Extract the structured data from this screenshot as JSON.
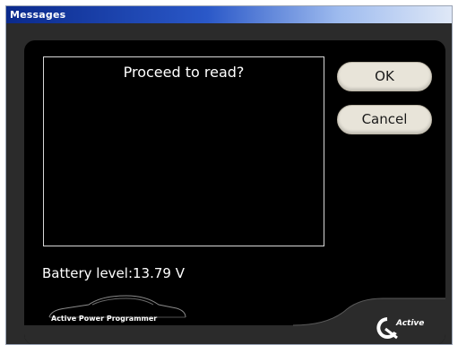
{
  "window": {
    "title": "Messages"
  },
  "message": {
    "text": "Proceed to read?"
  },
  "buttons": {
    "ok_label": "OK",
    "cancel_label": "Cancel"
  },
  "status": {
    "battery_text": "Battery level:13.79 V"
  },
  "branding": {
    "product_logo_text": "Active Power Programmer",
    "company_logo_text": "Active"
  },
  "colors": {
    "title_bar": "#0b2a8c",
    "panel_background": "#000000",
    "frame_background": "#2b2b2b",
    "button_background": "#e8e4d9",
    "text": "#ffffff"
  }
}
